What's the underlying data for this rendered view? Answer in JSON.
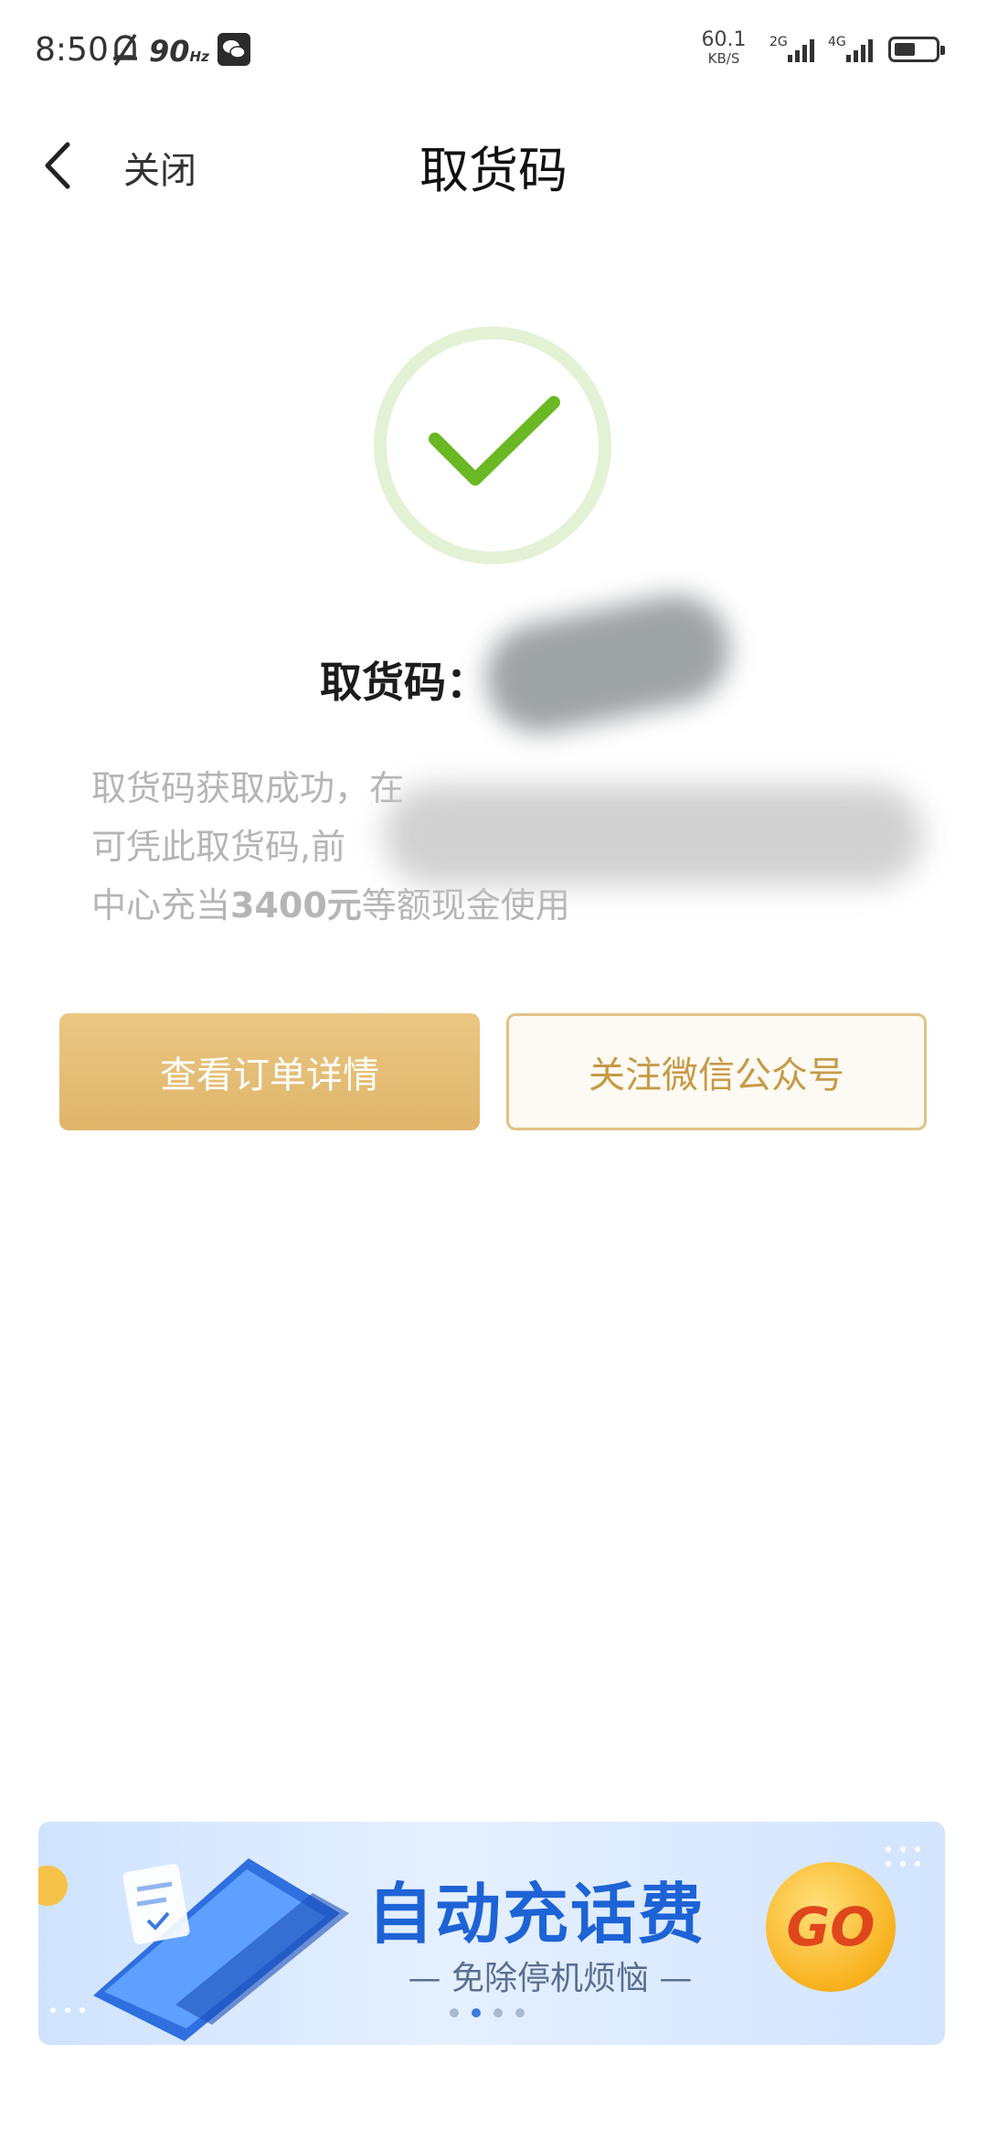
{
  "status_bar": {
    "time": "8:50",
    "refresh_rate": "90",
    "refresh_unit": "Hz",
    "net_speed_value": "60.1",
    "net_speed_unit": "KB/S",
    "sim1_label": "2G",
    "sim2_label": "4G"
  },
  "nav": {
    "close_label": "关闭",
    "title": "取货码"
  },
  "result": {
    "code_label": "取货码：",
    "desc_part1": "取货码获取成功，在",
    "desc_line2": "可凭此取货码,前",
    "desc_line3_prefix": "中心充当",
    "desc_amount": "3400元",
    "desc_line3_suffix": "等额现金使用"
  },
  "actions": {
    "view_order": "查看订单详情",
    "follow_wechat": "关注微信公众号"
  },
  "banner": {
    "title": "自动充话费",
    "subtitle": "— 免除停机烦恼 —",
    "go_label": "GO",
    "page_count": 4,
    "active_page": 2
  },
  "colors": {
    "success_green": "#6ab823",
    "gold_primary": "#e3bb73",
    "gold_text": "#c79a47",
    "banner_blue": "#1e63d6"
  }
}
